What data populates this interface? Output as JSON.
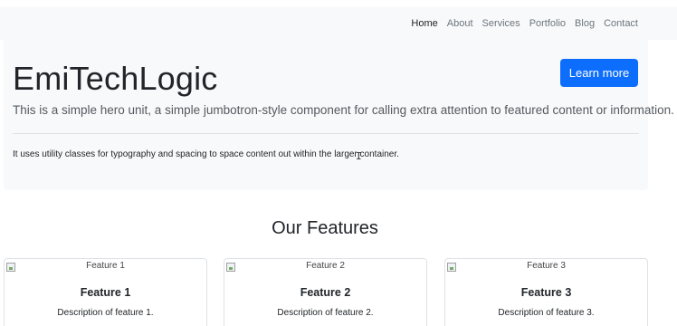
{
  "navbar": {
    "links": [
      {
        "label": "Home"
      },
      {
        "label": "About"
      },
      {
        "label": "Services"
      },
      {
        "label": "Portfolio"
      },
      {
        "label": "Blog"
      },
      {
        "label": "Contact"
      }
    ],
    "active": "Home"
  },
  "hero": {
    "title": "EmiTechLogic",
    "lead": "This is a simple hero unit, a simple jumbotron-style component for calling extra attention to featured content or information.",
    "text": "It uses utility classes for typography and spacing to space content out within the larger container.",
    "button_label": "Learn more"
  },
  "features": {
    "heading": "Our Features",
    "items": [
      {
        "img_alt": "Feature 1",
        "title": "Feature 1",
        "description": "Description of feature 1."
      },
      {
        "img_alt": "Feature 2",
        "title": "Feature 2",
        "description": "Description of feature 2."
      },
      {
        "img_alt": "Feature 3",
        "title": "Feature 3",
        "description": "Description of feature 3."
      }
    ]
  },
  "colors": {
    "primary": "#0d6efd",
    "light_bg": "#f8f9fa",
    "text": "#212529",
    "muted": "#6c757d"
  }
}
